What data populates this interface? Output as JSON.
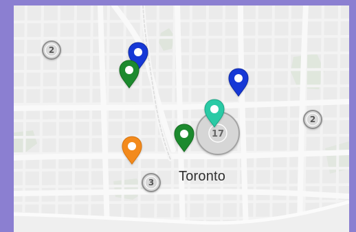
{
  "map": {
    "city_label": "Toronto",
    "clusters": [
      {
        "id": "cluster-2-left",
        "count": "2"
      },
      {
        "id": "cluster-17-center",
        "count": "17"
      },
      {
        "id": "cluster-2-right",
        "count": "2"
      },
      {
        "id": "cluster-3-bottom",
        "count": "3"
      }
    ],
    "markers": [
      {
        "id": "marker-blue-top-left",
        "color": "#1738d6"
      },
      {
        "id": "marker-green-top-left",
        "color": "#1f8a2d"
      },
      {
        "id": "marker-blue-right",
        "color": "#1738d6"
      },
      {
        "id": "marker-teal-center",
        "color": "#2ccaa5"
      },
      {
        "id": "marker-green-center",
        "color": "#1f8a2d"
      },
      {
        "id": "marker-orange-left",
        "color": "#f38a1a"
      }
    ],
    "colors": {
      "page_border": "#8b7fd1",
      "map_bg": "#ebebeb",
      "major_roads": "#f8f8f8",
      "minor_roads": "#f2f2f2",
      "parks": "#dfe5dc",
      "cluster_fill": "#d9d9d9",
      "cluster_stroke": "#8f8f8f"
    }
  }
}
